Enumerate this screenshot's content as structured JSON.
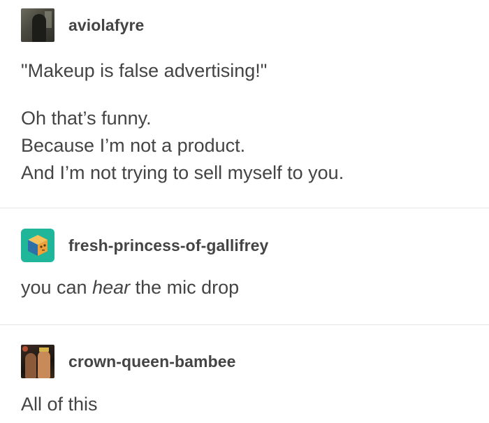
{
  "posts": [
    {
      "username": "aviolafyre",
      "avatar_icon": "user-photo-avatar",
      "quote": "\"Makeup is false advertising!\"",
      "lines": [
        "Oh that’s funny.",
        "Because I’m not a product.",
        "And I’m not trying to sell myself to you."
      ]
    },
    {
      "username": "fresh-princess-of-gallifrey",
      "avatar_icon": "orange-cube-avatar",
      "text_before": "you can ",
      "text_em": "hear",
      "text_after": " the mic drop"
    },
    {
      "username": "crown-queen-bambee",
      "avatar_icon": "user-photo-avatar",
      "text": "All of this"
    }
  ],
  "colors": {
    "text": "#444444",
    "divider": "#e6e6e6",
    "avatar_teal": "#20b69a",
    "cube_orange": "#f0a23a",
    "cube_blue": "#2f6fa8"
  }
}
